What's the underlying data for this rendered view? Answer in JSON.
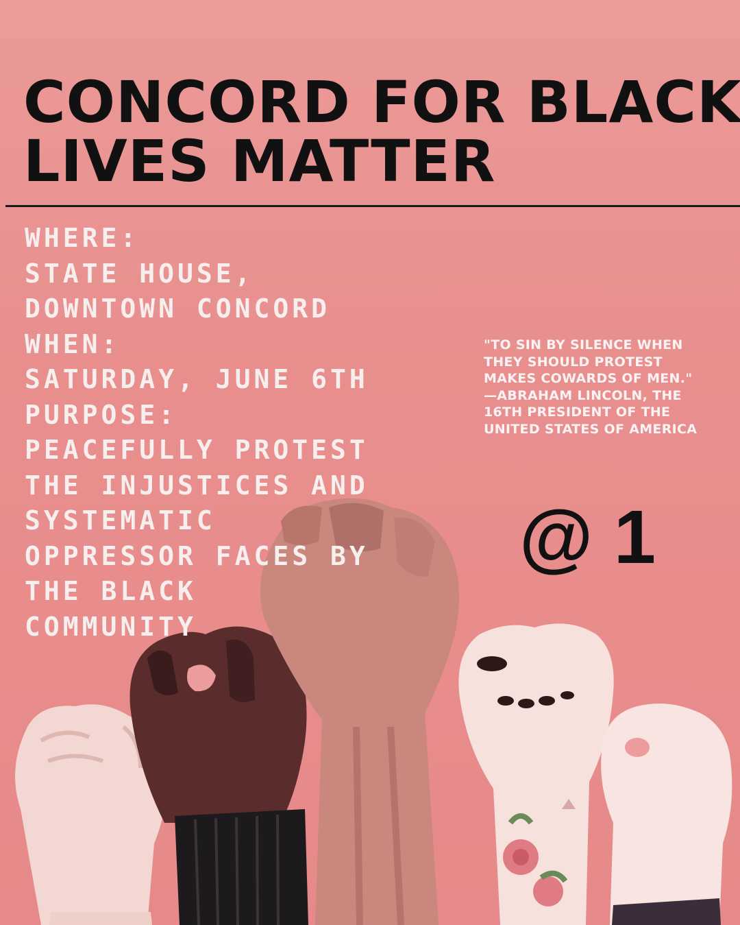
{
  "poster": {
    "title_lines": [
      "CONCORD FOR BLACK",
      "LIVES MATTER"
    ],
    "details_lines": [
      "WHERE:",
      "STATE HOUSE,",
      "DOWNTOWN CONCORD",
      "WHEN:",
      "SATURDAY, JUNE 6TH",
      "PURPOSE:",
      "PEACEFULLY PROTEST",
      "THE INJUSTICES AND",
      "SYSTEMATIC",
      "OPPRESSOR FACES BY",
      "THE BLACK",
      "COMMUNITY"
    ],
    "quote_lines": [
      "\"TO SIN BY SILENCE WHEN",
      "THEY SHOULD PROTEST",
      "MAKES COWARDS OF MEN.\"",
      "—ABRAHAM LINCOLN, THE",
      "16TH PRESIDENT OF THE",
      "UNITED STATES OF AMERICA"
    ],
    "time": "@ 1"
  },
  "colors": {
    "background": "#e99494",
    "title_text": "#111111",
    "details_text": "#f7eeee",
    "quote_text": "#fbf3f3"
  },
  "illustration": {
    "icon": "raised-fists-illustration",
    "fists": [
      "pale-fist",
      "dark-fist",
      "tan-fist",
      "light-fist-painted-nails",
      "light-fist-right"
    ]
  }
}
